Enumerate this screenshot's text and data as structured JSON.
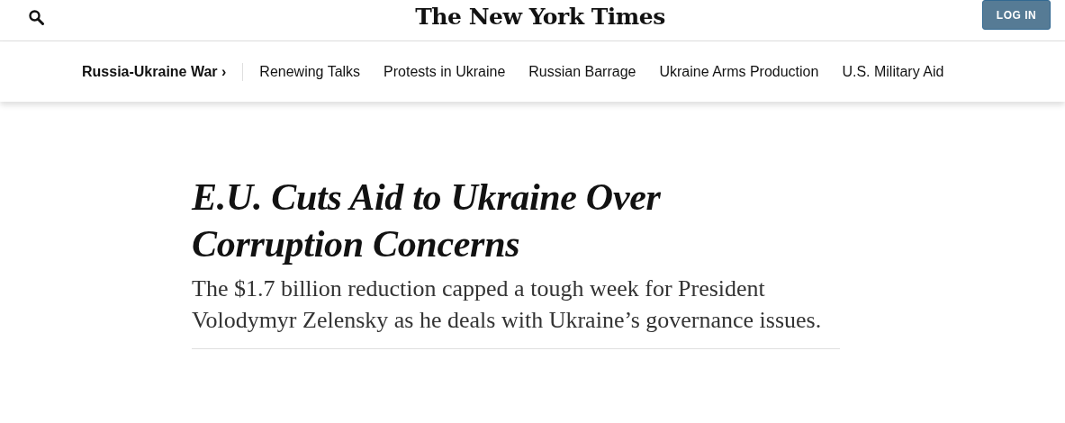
{
  "header": {
    "logo": "The New York Times",
    "login_button": "LOG IN"
  },
  "nav": {
    "section": "Russia-Ukraine War ›",
    "items": [
      "Renewing Talks",
      "Protests in Ukraine",
      "Russian Barrage",
      "Ukraine Arms Production",
      "U.S. Military Aid"
    ]
  },
  "article": {
    "headline": "E.U. Cuts Aid to Ukraine Over Corruption Concerns",
    "summary": "The $1.7 billion reduction capped a tough week for President Volodymyr Zelensky as he deals with Ukraine’s governance issues."
  }
}
